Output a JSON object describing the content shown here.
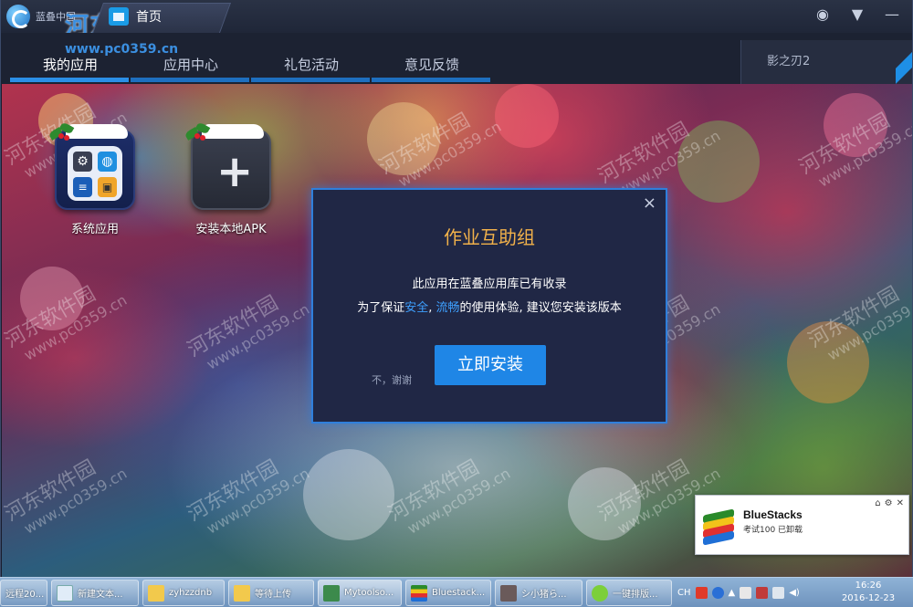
{
  "titlebar": {
    "logo_text": "蓝叠中国",
    "tab_home": "首页"
  },
  "watermark": {
    "brand": "河东软件园",
    "url": "www.pc0359.cn"
  },
  "nav": {
    "items": [
      {
        "label": "我的应用",
        "active": true
      },
      {
        "label": "应用中心",
        "active": false
      },
      {
        "label": "礼包活动",
        "active": false
      },
      {
        "label": "意见反馈",
        "active": false
      }
    ],
    "game_tab": "影之刃2"
  },
  "apps": [
    {
      "label": "系统应用"
    },
    {
      "label": "安装本地APK"
    }
  ],
  "modal": {
    "title": "作业互助组",
    "line1": "此应用在蓝叠应用库已有收录",
    "line2_prefix": "为了保证",
    "line2_hl1": "安全",
    "line2_sep": ", ",
    "line2_hl2": "流畅",
    "line2_suffix": "的使用体验, 建议您安装该版本",
    "decline": "不，谢谢",
    "install": "立即安装",
    "close": "×"
  },
  "toast": {
    "title": "BlueStacks",
    "message": "考试100 已卸载"
  },
  "taskbar": {
    "items": [
      {
        "label": "远程20..."
      },
      {
        "label": "新建文本..."
      },
      {
        "label": "zyhzzdnb"
      },
      {
        "label": "等待上传"
      },
      {
        "label": "Mytoolso..."
      },
      {
        "label": "Bluestack..."
      },
      {
        "label": "シ小猪ら..."
      },
      {
        "label": "一键排版..."
      }
    ],
    "lang": "CH",
    "time": "16:26",
    "date": "2016-12-23"
  },
  "colors": {
    "accent": "#1f86e6",
    "modal_title": "#f1b14a",
    "highlight": "#3ea0ff"
  }
}
